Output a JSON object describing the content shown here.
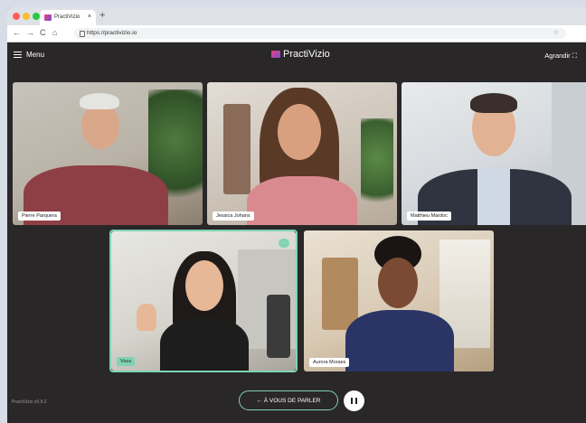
{
  "browser": {
    "tab_title": "PractiVizio",
    "tab_close": "×",
    "new_tab": "+",
    "url": "https://practivizio.io",
    "nav_back": "←",
    "nav_forward": "→",
    "nav_reload": "C",
    "nav_home": "⌂",
    "bookmark_star": "☆"
  },
  "app": {
    "menu_label": "Menu",
    "brand": "PractiVizio",
    "expand_label": "Agrandir",
    "expand_icon": "⛶",
    "version": "PractiVizio v0.9.2",
    "talk_button": "← À VOUS DE PARLER"
  },
  "participants": [
    {
      "name": "Pierre Parquera",
      "self": false
    },
    {
      "name": "Jessica Johans",
      "self": false
    },
    {
      "name": "Matthieu Mardoc",
      "self": false
    },
    {
      "name": "Vous",
      "self": true
    },
    {
      "name": "Aurora Moraes",
      "self": false
    }
  ],
  "colors": {
    "app_background": "#2a2728",
    "accent": "#7fd3b3",
    "brand_gradient_start": "#e8417a",
    "brand_gradient_end": "#7d4cdb"
  },
  "icons": {
    "more": "···"
  }
}
